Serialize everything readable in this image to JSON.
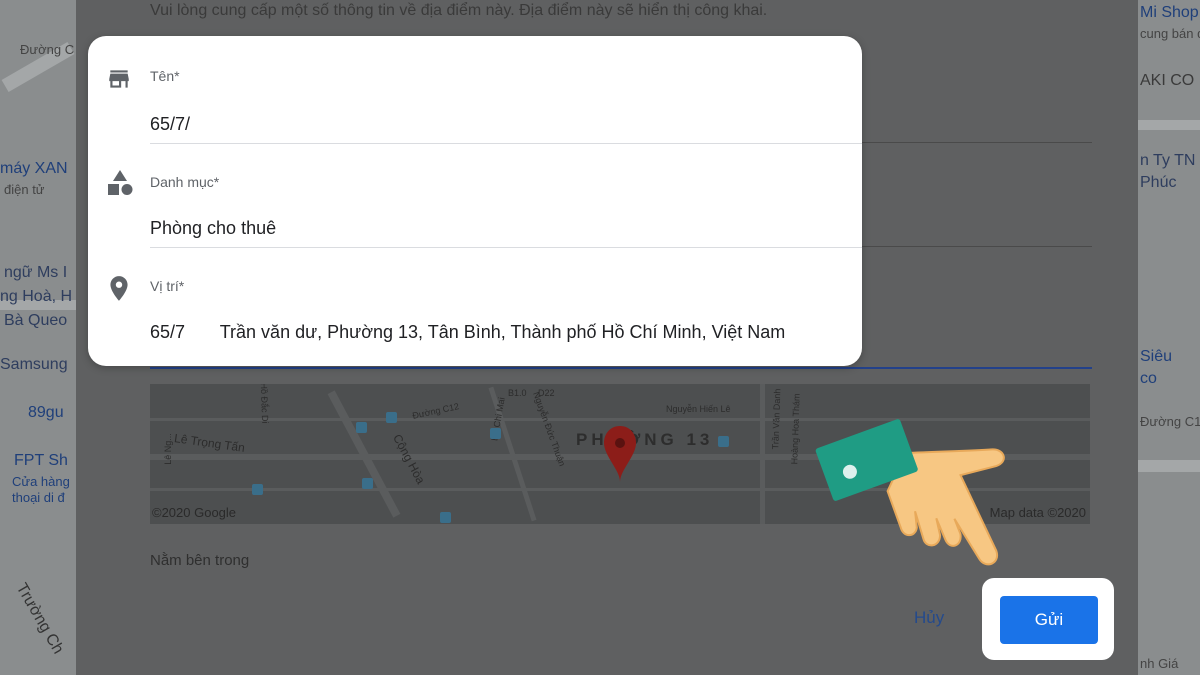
{
  "dialog": {
    "hint": "Vui lòng cung cấp một số thông tin về địa điểm này. Địa điểm này sẽ hiển thị công khai.",
    "inside_label": "Nằm bên trong",
    "cancel_label": "Hủy",
    "submit_label": "Gửi"
  },
  "form": {
    "name": {
      "label": "Tên*",
      "value": "65/7/",
      "icon": "storefront-icon"
    },
    "category": {
      "label": "Danh mục*",
      "value": "Phòng cho thuê",
      "icon": "category-shapes-icon"
    },
    "location": {
      "label": "Vị trí*",
      "value": "65/7       Trần văn dư, Phường 13, Tân Bình, Thành phố Hồ Chí Minh, Việt Nam",
      "icon": "location-pin-icon"
    }
  },
  "mini_map": {
    "district": "PHƯỜNG 13",
    "copyright_left": "©2020 Google",
    "copyright_right": "Map data ©2020",
    "streets": [
      "Lê Trọng Tấn",
      "Cộng Hòa",
      "Đường C12",
      "Nguyễn Đức Thuận",
      "Nguyễn Hiến Lê",
      "Trần Văn Danh",
      "Hoàng Hoa Thám",
      "B1.0",
      "D22",
      "Hồ Đắc Di",
      "Bà Chi Mai",
      "Lê Ng..."
    ]
  },
  "background_map": {
    "labels": [
      "Đường C",
      "máy XAN",
      "điện tử",
      "ngữ Ms I",
      "ng Hoà, H",
      "Bà Queo",
      "Samsung",
      "89gu",
      "FPT Sh",
      "Cửa hàng",
      "thoại di đ",
      "Trường Ch",
      "Mi Shop",
      "cung bán đồ",
      "AKI CO",
      "n Ty TN",
      "Phúc",
      "Siêu",
      "co",
      "Đường C1",
      "nh Giá"
    ]
  },
  "colors": {
    "primary": "#1a73e8",
    "pin": "#c0241f",
    "hand_cuff": "#1f9c84",
    "hand_skin": "#f7c783"
  }
}
